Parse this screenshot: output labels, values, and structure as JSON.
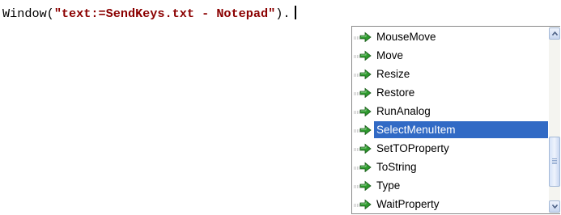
{
  "editor": {
    "code_prefix": "Window(",
    "code_string": "\"text:=SendKeys.txt - Notepad\"",
    "code_suffix": ")."
  },
  "autocomplete": {
    "items": [
      {
        "label": "MouseMove",
        "icon": "method-icon",
        "selected": false
      },
      {
        "label": "Move",
        "icon": "method-icon",
        "selected": false
      },
      {
        "label": "Resize",
        "icon": "method-icon",
        "selected": false
      },
      {
        "label": "Restore",
        "icon": "method-icon",
        "selected": false
      },
      {
        "label": "RunAnalog",
        "icon": "method-icon",
        "selected": false
      },
      {
        "label": "SelectMenuItem",
        "icon": "method-icon",
        "selected": true
      },
      {
        "label": "SetTOProperty",
        "icon": "method-icon",
        "selected": false
      },
      {
        "label": "ToString",
        "icon": "method-icon",
        "selected": false
      },
      {
        "label": "Type",
        "icon": "method-icon",
        "selected": false
      },
      {
        "label": "WaitProperty",
        "icon": "method-icon",
        "selected": false
      }
    ],
    "scroll_position": 0.75
  },
  "colors": {
    "string_literal": "#8b0000",
    "selection": "#316ac5",
    "method_icon": "#2e9a2e"
  }
}
